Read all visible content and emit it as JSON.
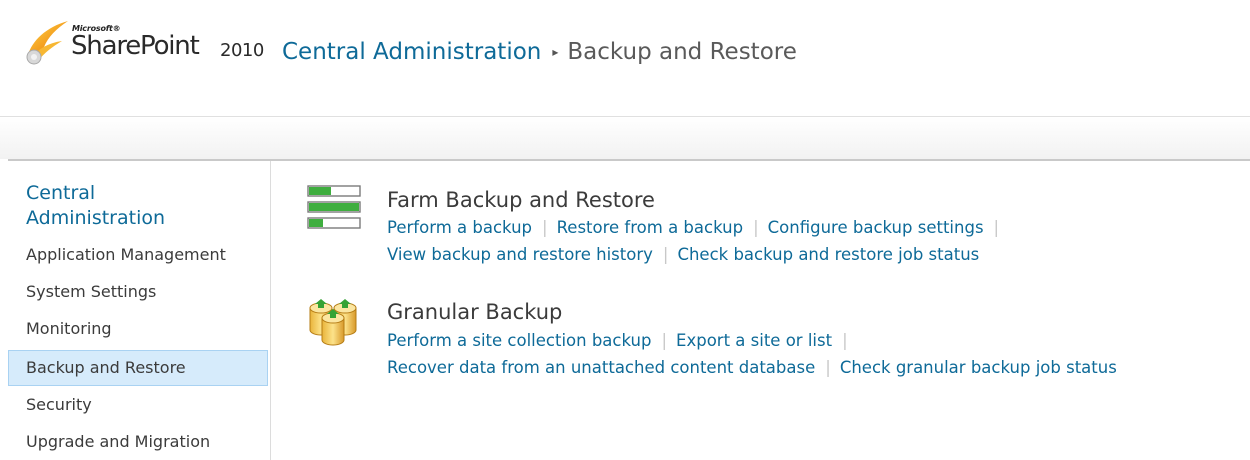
{
  "header": {
    "logo_microsoft": "Microsoft®",
    "logo_product": "SharePoint",
    "logo_year": "2010",
    "breadcrumb_root": "Central Administration",
    "breadcrumb_separator": "▸",
    "breadcrumb_current": "Backup and Restore"
  },
  "leftnav": {
    "title": "Central Administration",
    "items": [
      {
        "label": "Application Management",
        "selected": false
      },
      {
        "label": "System Settings",
        "selected": false
      },
      {
        "label": "Monitoring",
        "selected": false
      },
      {
        "label": "Backup and Restore",
        "selected": true
      },
      {
        "label": "Security",
        "selected": false
      },
      {
        "label": "Upgrade and Migration",
        "selected": false
      }
    ]
  },
  "sections": [
    {
      "title": "Farm Backup and Restore",
      "icon": "farm-backup-icon",
      "row1": [
        "Perform a backup",
        "Restore from a backup",
        "Configure backup settings"
      ],
      "row2": [
        "View backup and restore history",
        "Check backup and restore job status"
      ]
    },
    {
      "title": "Granular Backup",
      "icon": "granular-backup-icon",
      "row1": [
        "Perform a site collection backup",
        "Export a site or list"
      ],
      "row2": [
        "Recover data from an unattached content database",
        "Check granular backup job status"
      ]
    }
  ],
  "colors": {
    "link": "#0e6a98",
    "selected_bg": "#d6ebfb",
    "selected_border": "#a9d2f2"
  }
}
